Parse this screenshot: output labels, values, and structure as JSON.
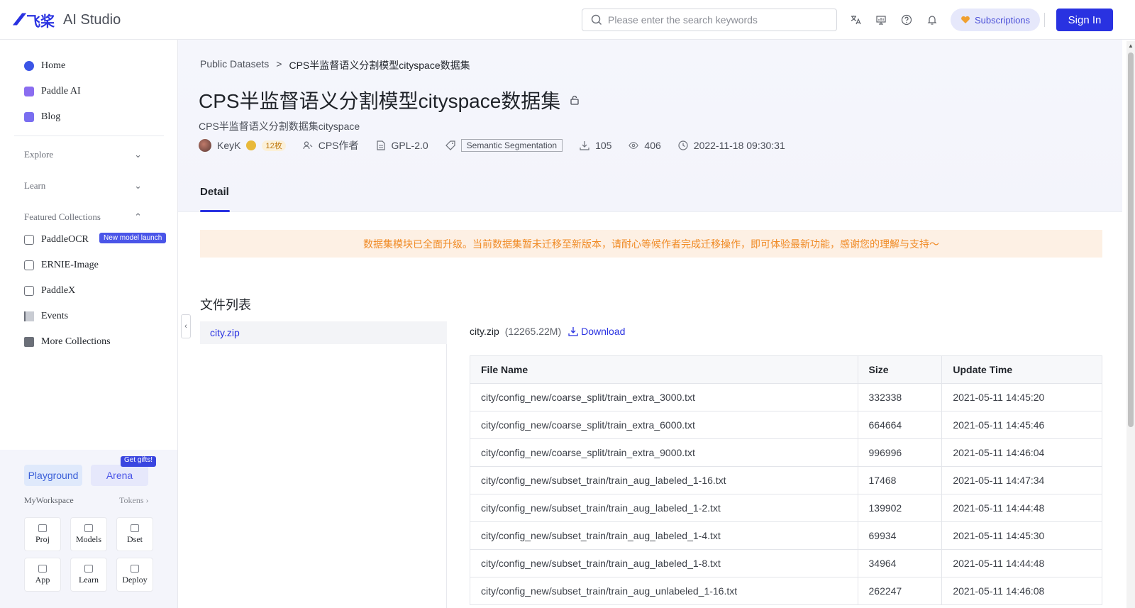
{
  "header": {
    "logo_mark": "卐",
    "logo_cn": "飞桨",
    "logo_text": "AI Studio",
    "search_placeholder": "Please enter the search keywords",
    "subscriptions_label": "Subscriptions",
    "signin_label": "Sign In"
  },
  "sidebar": {
    "nav": [
      {
        "label": "Home",
        "color": "#3b55e6"
      },
      {
        "label": "Paddle AI",
        "color": "#8a6df0"
      },
      {
        "label": "Blog",
        "color": "#7a6ef0"
      }
    ],
    "sections": [
      "Explore",
      "Learn",
      "Featured Collections"
    ],
    "collections": [
      "PaddleOCR",
      "ERNIE-Image",
      "PaddleX",
      "Events",
      "More Collections"
    ],
    "new_badge": "New model launch",
    "playground_label": "Playground",
    "arena_label": "Arena",
    "gift_badge": "Get gifts!",
    "workspace_label": "MyWorkspace",
    "tokens_label": "Tokens",
    "tiles": [
      "Proj",
      "Models",
      "Dset",
      "App",
      "Learn",
      "Deploy"
    ]
  },
  "breadcrumb": {
    "parent": "Public Datasets",
    "separator": ">",
    "current": "CPS半监督语义分割模型cityspace数据集"
  },
  "dataset": {
    "title": "CPS半监督语义分割模型cityspace数据集",
    "subtitle": "CPS半监督语义分割数据集cityspace",
    "author": "KeyK",
    "level": "12枚",
    "creator": "CPS作者",
    "license": "GPL-2.0",
    "tag": "Semantic Segmentation",
    "downloads": "105",
    "views": "406",
    "updated": "2022-11-18 09:30:31"
  },
  "tabs": {
    "detail": "Detail"
  },
  "notice": "数据集模块已全面升级。当前数据集暂未迁移至新版本，请耐心等候作者完成迁移操作，即可体验最新功能，感谢您的理解与支持～",
  "files": {
    "title": "文件列表",
    "list": [
      "city.zip"
    ],
    "current_name": "city.zip",
    "current_size": "(12265.22M)",
    "download_label": "Download",
    "columns": [
      "File Name",
      "Size",
      "Update Time"
    ],
    "rows": [
      [
        "city/config_new/coarse_split/train_extra_3000.txt",
        "332338",
        "2021-05-11 14:45:20"
      ],
      [
        "city/config_new/coarse_split/train_extra_6000.txt",
        "664664",
        "2021-05-11 14:45:46"
      ],
      [
        "city/config_new/coarse_split/train_extra_9000.txt",
        "996996",
        "2021-05-11 14:46:04"
      ],
      [
        "city/config_new/subset_train/train_aug_labeled_1-16.txt",
        "17468",
        "2021-05-11 14:47:34"
      ],
      [
        "city/config_new/subset_train/train_aug_labeled_1-2.txt",
        "139902",
        "2021-05-11 14:44:48"
      ],
      [
        "city/config_new/subset_train/train_aug_labeled_1-4.txt",
        "69934",
        "2021-05-11 14:45:30"
      ],
      [
        "city/config_new/subset_train/train_aug_labeled_1-8.txt",
        "34964",
        "2021-05-11 14:44:48"
      ],
      [
        "city/config_new/subset_train/train_aug_unlabeled_1-16.txt",
        "262247",
        "2021-05-11 14:46:08"
      ]
    ]
  },
  "colors": {
    "brand": "#2932e1",
    "notice_text": "#f08a24",
    "notice_bg": "#fdf0e4"
  }
}
